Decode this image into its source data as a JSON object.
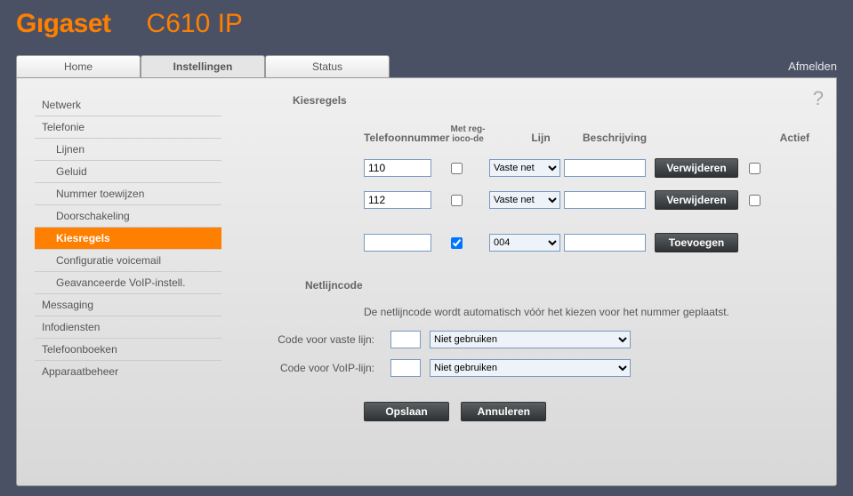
{
  "header": {
    "brand": "Gıgaset",
    "model": "C610 IP",
    "logout": "Afmelden"
  },
  "tabs": {
    "home": "Home",
    "settings": "Instellingen",
    "status": "Status"
  },
  "nav": {
    "network": "Netwerk",
    "telephony": "Telefonie",
    "lines": "Lijnen",
    "audio": "Geluid",
    "number_assign": "Nummer toewijzen",
    "forwarding": "Doorschakeling",
    "dialplans": "Kiesregels",
    "voicemail": "Configuratie voicemail",
    "adv_voip": "Geavanceerde VoIP-instell.",
    "messaging": "Messaging",
    "infoservices": "Infodiensten",
    "phonebooks": "Telefoonboeken",
    "device": "Apparaatbeheer"
  },
  "section": {
    "dialplans": "Kiesregels",
    "netline": "Netlijncode"
  },
  "columns": {
    "phone": "Telefoonnummer",
    "area": "Met reg-ioco-de",
    "line": "Lijn",
    "desc": "Beschrijving",
    "active": "Actief"
  },
  "rules": [
    {
      "phone": "110",
      "area": false,
      "line": "Vaste net",
      "desc": "",
      "btn": "Verwijderen",
      "active": false
    },
    {
      "phone": "112",
      "area": false,
      "line": "Vaste net",
      "desc": "",
      "btn": "Verwijderen",
      "active": false
    }
  ],
  "newrule": {
    "phone": "",
    "area": true,
    "line": "004",
    "desc": "",
    "btn": "Toevoegen"
  },
  "line_options": [
    "Vaste net",
    "004"
  ],
  "netline": {
    "info": "De netlijncode wordt automatisch vóór het kiezen voor het nummer geplaatst.",
    "fixed_label": "Code voor vaste lijn:",
    "voip_label": "Code voor VoIP-lijn:",
    "fixed_code": "",
    "voip_code": "",
    "fixed_mode": "Niet gebruiken",
    "voip_mode": "Niet gebruiken",
    "mode_options": [
      "Niet gebruiken"
    ]
  },
  "buttons": {
    "save": "Opslaan",
    "cancel": "Annuleren"
  }
}
